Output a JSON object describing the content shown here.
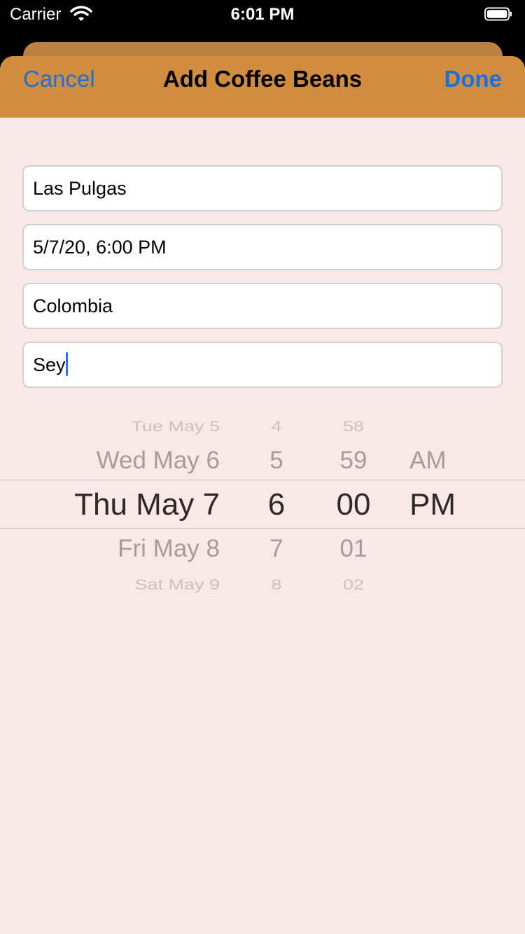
{
  "status_bar": {
    "carrier": "Carrier",
    "time": "6:01 PM",
    "wifi_icon": "wifi-icon",
    "battery_icon": "battery-icon"
  },
  "nav": {
    "cancel_label": "Cancel",
    "title": "Add Coffee Beans",
    "done_label": "Done",
    "bar_color": "#d18c3e",
    "button_color": "#1d6fde"
  },
  "fields": [
    {
      "value": "Las Pulgas"
    },
    {
      "value": "5/7/20, 6:00 PM"
    },
    {
      "value": "Colombia"
    },
    {
      "value": "Sey"
    }
  ],
  "picker": {
    "dates": [
      "Tue May 5",
      "Wed May 6",
      "Thu May 7",
      "Fri May 8",
      "Sat May 9"
    ],
    "hours": [
      "4",
      "5",
      "6",
      "7",
      "8"
    ],
    "minutes": [
      "58",
      "59",
      "00",
      "01",
      "02"
    ],
    "ampm": [
      "AM",
      "PM"
    ]
  },
  "colors": {
    "sheet_background": "#f8e9e6",
    "caret": "#3c6cf0"
  }
}
